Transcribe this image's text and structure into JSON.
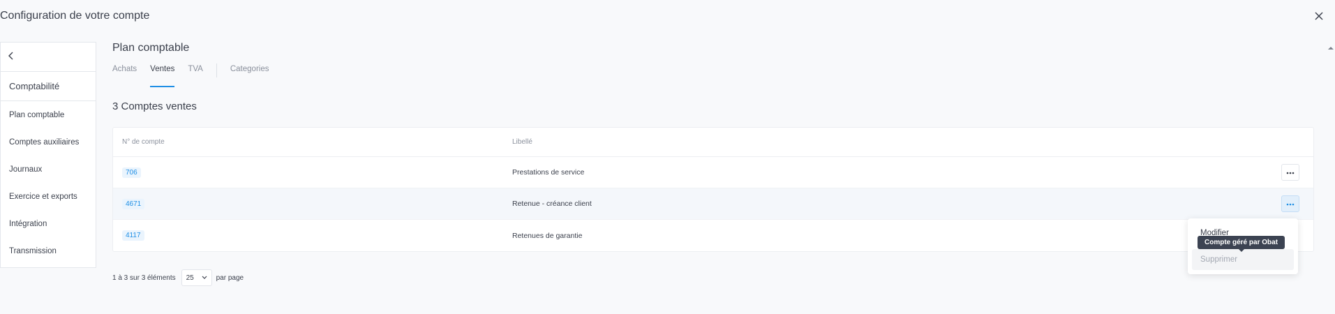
{
  "header": {
    "title": "Configuration de votre compte"
  },
  "sidebar": {
    "section_title": "Comptabilité",
    "items": [
      {
        "label": "Plan comptable"
      },
      {
        "label": "Comptes auxiliaires"
      },
      {
        "label": "Journaux"
      },
      {
        "label": "Exercice et exports"
      },
      {
        "label": "Intégration"
      },
      {
        "label": "Transmission"
      }
    ]
  },
  "main": {
    "title": "Plan comptable",
    "tabs": [
      {
        "label": "Achats"
      },
      {
        "label": "Ventes"
      },
      {
        "label": "TVA"
      },
      {
        "label": "Categories"
      }
    ],
    "active_tab": "Ventes",
    "count_title": "3 Comptes ventes",
    "table": {
      "headers": [
        "N° de compte",
        "Libellé"
      ],
      "rows": [
        {
          "account": "706",
          "label": "Prestations de service"
        },
        {
          "account": "4671",
          "label": "Retenue - créance client"
        },
        {
          "account": "4117",
          "label": "Retenues de garantie"
        }
      ]
    },
    "pagination": {
      "range_text": "1 à 3 sur 3 éléments",
      "page_size": "25",
      "per_page_label": "par page"
    }
  },
  "menu": {
    "items": [
      {
        "label": "Modifier"
      },
      {
        "label": "Supprimer"
      }
    ],
    "tooltip": "Compte géré par Obat"
  },
  "colors": {
    "accent": "#1f8fe5",
    "background": "#f8f9fb",
    "tooltip_bg": "#3c4352"
  },
  "icons": {
    "close": "close-icon",
    "back": "chevron-left-icon",
    "more": "more-horizontal-icon",
    "dropdown": "chevron-down-icon"
  }
}
